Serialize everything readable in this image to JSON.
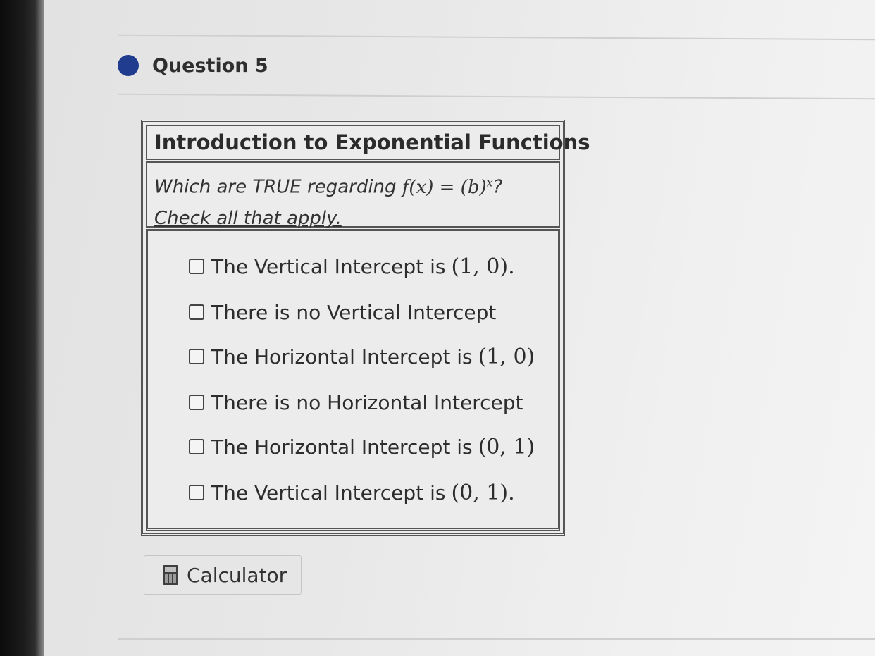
{
  "question": {
    "title": "Question 5"
  },
  "card": {
    "heading": "Introduction to Exponential Functions",
    "prompt_text": "Which are TRUE regarding ",
    "prompt_math": "f(x) = (b)",
    "prompt_exponent": "x",
    "prompt_end": "?",
    "instruction": "Check all that apply."
  },
  "options": [
    {
      "text": "The Vertical Intercept is",
      "math": "(1, 0).",
      "checked": false
    },
    {
      "text": "There is no Vertical Intercept",
      "math": "",
      "checked": false
    },
    {
      "text": "The Horizontal Intercept is",
      "math": "(1, 0)",
      "checked": false
    },
    {
      "text": "There is no Horizontal Intercept",
      "math": "",
      "checked": false
    },
    {
      "text": "The Horizontal Intercept is",
      "math": "(0, 1)",
      "checked": false
    },
    {
      "text": "The Vertical Intercept is",
      "math": "(0, 1).",
      "checked": false
    }
  ],
  "toolbar": {
    "calculator_label": "Calculator",
    "calculator_icon": "calculator-icon"
  },
  "colors": {
    "status_dot": "#1f3c8f"
  }
}
